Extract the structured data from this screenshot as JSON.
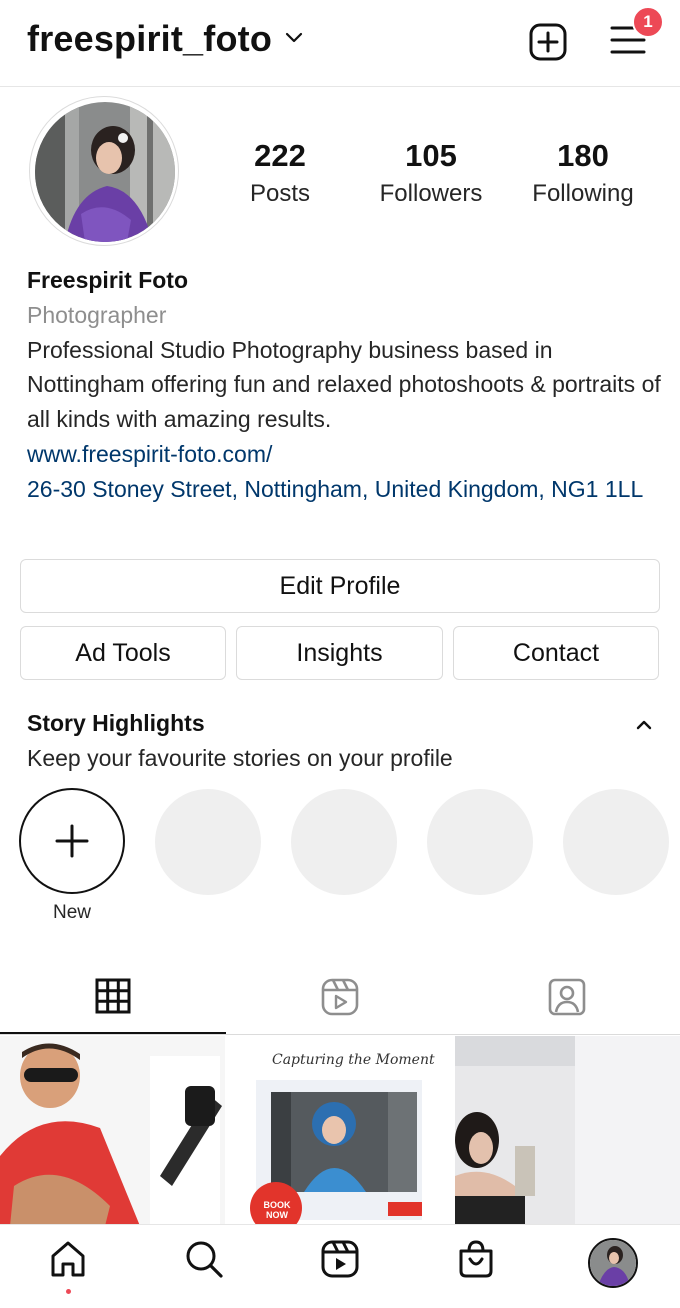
{
  "header": {
    "username": "freespirit_foto",
    "notification_count": "1"
  },
  "stats": [
    {
      "value": "222",
      "label": "Posts"
    },
    {
      "value": "105",
      "label": "Followers"
    },
    {
      "value": "180",
      "label": "Following"
    }
  ],
  "profile": {
    "name": "Freespirit Foto",
    "category": "Photographer",
    "bio": "Professional Studio Photography business based in Nottingham offering fun and relaxed photoshoots & portraits of all kinds with amazing results.",
    "website": "www.freespirit-foto.com/",
    "address": "26-30 Stoney Street, Nottingham, United Kingdom, NG1 1LL"
  },
  "buttons": {
    "edit_profile": "Edit Profile",
    "ad_tools": "Ad Tools",
    "insights": "Insights",
    "contact": "Contact"
  },
  "highlights": {
    "title": "Story Highlights",
    "subtitle": "Keep your favourite stories on your profile",
    "new_label": "New"
  },
  "posts": [
    {
      "caption": ""
    },
    {
      "caption": "Capturing the Moment",
      "badge": "BOOK NOW"
    },
    {
      "caption": ""
    }
  ],
  "colors": {
    "badge": "#ed4956",
    "link": "#00376b",
    "border": "#dbdbdb",
    "placeholder": "#efefef"
  },
  "icons": [
    "chevron-down-icon",
    "new-post-icon",
    "menu-icon",
    "plus-icon",
    "chevron-up-icon",
    "grid-icon",
    "reels-icon",
    "tagged-icon",
    "home-icon",
    "search-icon",
    "shop-icon"
  ]
}
